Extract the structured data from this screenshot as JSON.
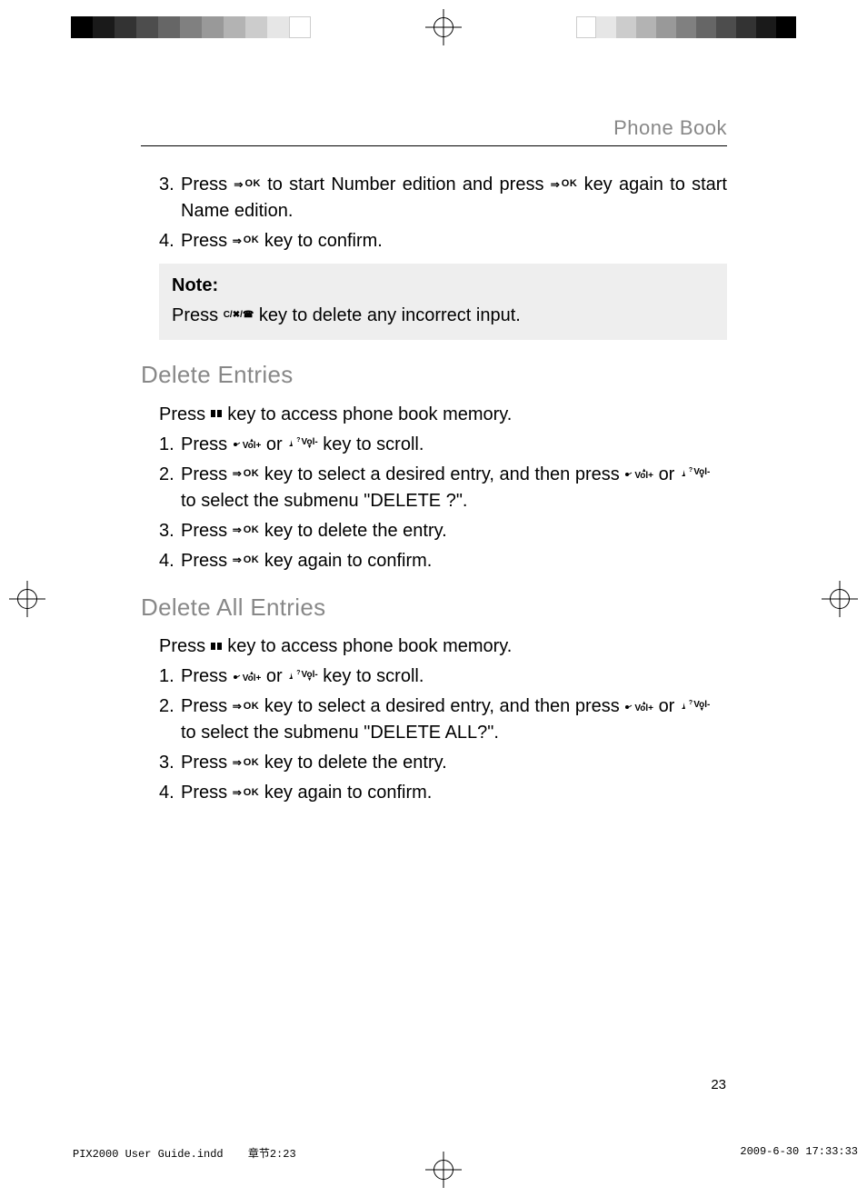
{
  "header": {
    "section_title": "Phone Book"
  },
  "body": {
    "step3": "to start Number edition and press",
    "step3_tail": "key again to start Name edition.",
    "step4": "key to confirm.",
    "press_label": "Press",
    "numbers": {
      "three": "3.",
      "four": "4.",
      "one": "1.",
      "two": "2."
    },
    "note": {
      "title": "Note:",
      "text_a": "Press",
      "text_b": "key to delete any incorrect input."
    },
    "sec_delete": {
      "heading": "Delete Entries",
      "intro_b": "key to access phone book memory.",
      "s1_mid": "or",
      "s1_tail": "key to scroll.",
      "s2_a": "key to select a desired entry, and then press",
      "s2_b": "or",
      "s2_c": "to select the submenu \"DELETE ?\".",
      "s3": "key to delete the entry.",
      "s4": "key again to confirm."
    },
    "sec_delete_all": {
      "heading": "Delete All Entries",
      "intro_b": "key to access phone book memory.",
      "s1_mid": "or",
      "s1_tail": "key to scroll.",
      "s2_a": "key to select a desired entry, and then press",
      "s2_b": "or",
      "s2_c": "to select the submenu \"DELETE ALL?\".",
      "s3": "key to delete the entry.",
      "s4": "key again to confirm."
    }
  },
  "icons": {
    "ok": "OK",
    "volplus": "Vol+",
    "volminus": "Vol-",
    "clear": "C/"
  },
  "page_number": "23",
  "footer": {
    "filename": "PIX2000 User Guide.indd",
    "section": "章节2:23",
    "timestamp": "2009-6-30   17:33:33"
  },
  "colorbars": {
    "left": [
      "#000000",
      "#1a1a1a",
      "#333333",
      "#4d4d4d",
      "#666666",
      "#808080",
      "#999999",
      "#b3b3b3",
      "#cccccc",
      "#e6e6e6",
      "#ffffff"
    ],
    "right_top": [
      "#ffffff",
      "#e6e6e6",
      "#cccccc",
      "#b3b3b3",
      "#999999",
      "#808080",
      "#666666",
      "#4d4d4d",
      "#333333",
      "#1a1a1a",
      "#000000"
    ]
  }
}
